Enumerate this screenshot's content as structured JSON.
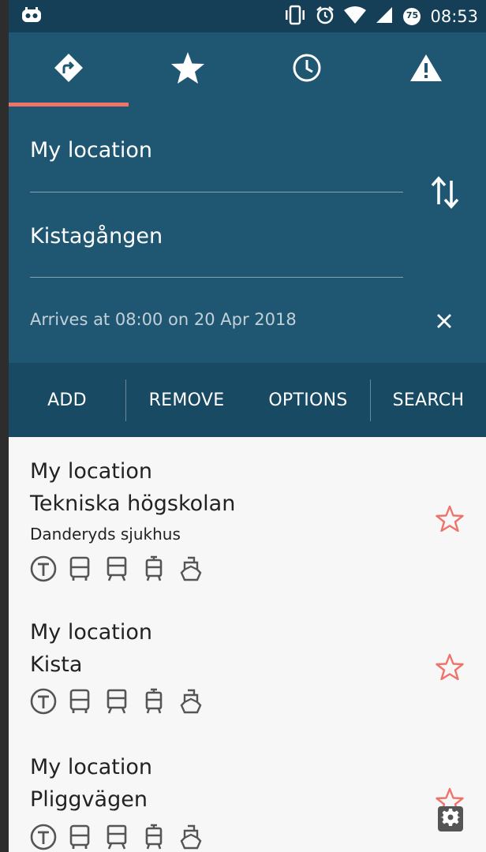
{
  "status_bar": {
    "time": "08:53",
    "battery_level": "75",
    "icons": [
      "cyanogen-icon",
      "vibrate-icon",
      "alarm-icon",
      "wifi-icon",
      "signal-icon",
      "battery-icon"
    ]
  },
  "tabs": [
    {
      "name": "directions",
      "icon": "directions-icon",
      "selected": true
    },
    {
      "name": "favorites",
      "icon": "star-icon",
      "selected": false
    },
    {
      "name": "history",
      "icon": "clock-icon",
      "selected": false
    },
    {
      "name": "deviations",
      "icon": "warning-icon",
      "selected": false
    }
  ],
  "search": {
    "from": "My location",
    "to": "Kistagången",
    "time_info": "Arrives at 08:00 on 20 Apr 2018"
  },
  "actions": {
    "add": "ADD",
    "remove": "REMOVE",
    "options": "OPTIONS",
    "search": "SEARCH"
  },
  "trips": [
    {
      "from": "My location",
      "to": "Tekniska högskolan",
      "via": "Danderyds sjukhus",
      "modes": [
        "metro",
        "bus",
        "train",
        "tram",
        "ferry"
      ]
    },
    {
      "from": "My location",
      "to": "Kista",
      "modes": [
        "metro",
        "bus",
        "train",
        "tram",
        "ferry"
      ]
    },
    {
      "from": "My location",
      "to": "Pliggvägen",
      "modes": [
        "metro",
        "bus",
        "train",
        "tram",
        "ferry"
      ]
    }
  ],
  "colors": {
    "status_bar": "#153f56",
    "header": "#1f5772",
    "action_bar": "#184a63",
    "accent": "#f0736a",
    "list_bg": "#f7f7f7"
  }
}
